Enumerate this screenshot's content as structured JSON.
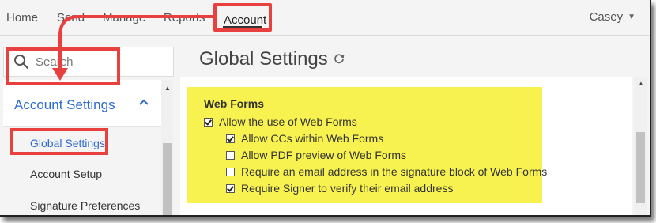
{
  "nav": {
    "items": [
      "Home",
      "Send",
      "Manage",
      "Reports",
      "Account"
    ],
    "user": "Casey"
  },
  "sidebar": {
    "search_placeholder": "Search",
    "section_label": "Account Settings",
    "items": [
      "Global Settings",
      "Account Setup",
      "Signature Preferences"
    ]
  },
  "main": {
    "title": "Global Settings",
    "section_title": "Web Forms",
    "options": [
      {
        "label": "Allow the use of Web Forms",
        "checked": true
      },
      {
        "label": "Allow CCs within Web Forms",
        "checked": true
      },
      {
        "label": "Allow PDF preview of Web Forms",
        "checked": false
      },
      {
        "label": "Require an email address in the signature block of Web Forms",
        "checked": false
      },
      {
        "label": "Require Signer to verify their email address",
        "checked": true
      }
    ]
  },
  "colors": {
    "annotation_red": "#e8403f",
    "highlight_yellow": "#f7f24f",
    "link_blue": "#2d6bd1"
  }
}
